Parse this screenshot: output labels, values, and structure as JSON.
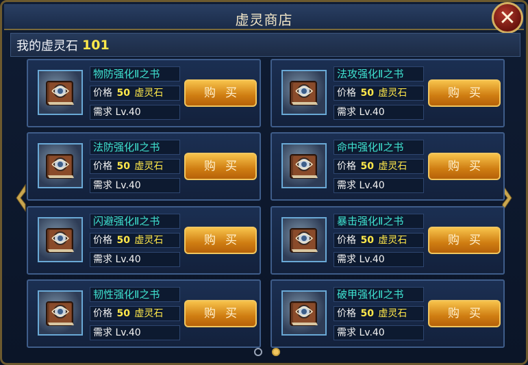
{
  "window": {
    "title": "虚灵商店",
    "close_icon": "close-icon"
  },
  "stones": {
    "label": "我的虚灵石",
    "value": "101"
  },
  "items": [
    {
      "name": "物防强化Ⅱ之书",
      "price_label": "价格",
      "price": "50",
      "currency": "虚灵石",
      "req": "需求 Lv.40",
      "buy_label": "购买",
      "icon": "book-icon"
    },
    {
      "name": "法攻强化Ⅱ之书",
      "price_label": "价格",
      "price": "50",
      "currency": "虚灵石",
      "req": "需求 Lv.40",
      "buy_label": "购买",
      "icon": "book-icon"
    },
    {
      "name": "法防强化Ⅱ之书",
      "price_label": "价格",
      "price": "50",
      "currency": "虚灵石",
      "req": "需求 Lv.40",
      "buy_label": "购买",
      "icon": "book-icon"
    },
    {
      "name": "命中强化Ⅱ之书",
      "price_label": "价格",
      "price": "50",
      "currency": "虚灵石",
      "req": "需求 Lv.40",
      "buy_label": "购买",
      "icon": "book-icon"
    },
    {
      "name": "闪避强化Ⅱ之书",
      "price_label": "价格",
      "price": "50",
      "currency": "虚灵石",
      "req": "需求 Lv.40",
      "buy_label": "购买",
      "icon": "book-icon"
    },
    {
      "name": "暴击强化Ⅱ之书",
      "price_label": "价格",
      "price": "50",
      "currency": "虚灵石",
      "req": "需求 Lv.40",
      "buy_label": "购买",
      "icon": "book-icon"
    },
    {
      "name": "韧性强化Ⅱ之书",
      "price_label": "价格",
      "price": "50",
      "currency": "虚灵石",
      "req": "需求 Lv.40",
      "buy_label": "购买",
      "icon": "book-icon"
    },
    {
      "name": "破甲强化Ⅱ之书",
      "price_label": "价格",
      "price": "50",
      "currency": "虚灵石",
      "req": "需求 Lv.40",
      "buy_label": "购买",
      "icon": "book-icon"
    }
  ],
  "navigation": {
    "prev_icon": "chevron-left-icon",
    "next_icon": "chevron-right-icon",
    "pages": 2,
    "current_page": 2
  },
  "colors": {
    "accent_gold": "#f1c65f",
    "item_name": "#3fe2d0",
    "price_yellow": "#ffe84a"
  }
}
